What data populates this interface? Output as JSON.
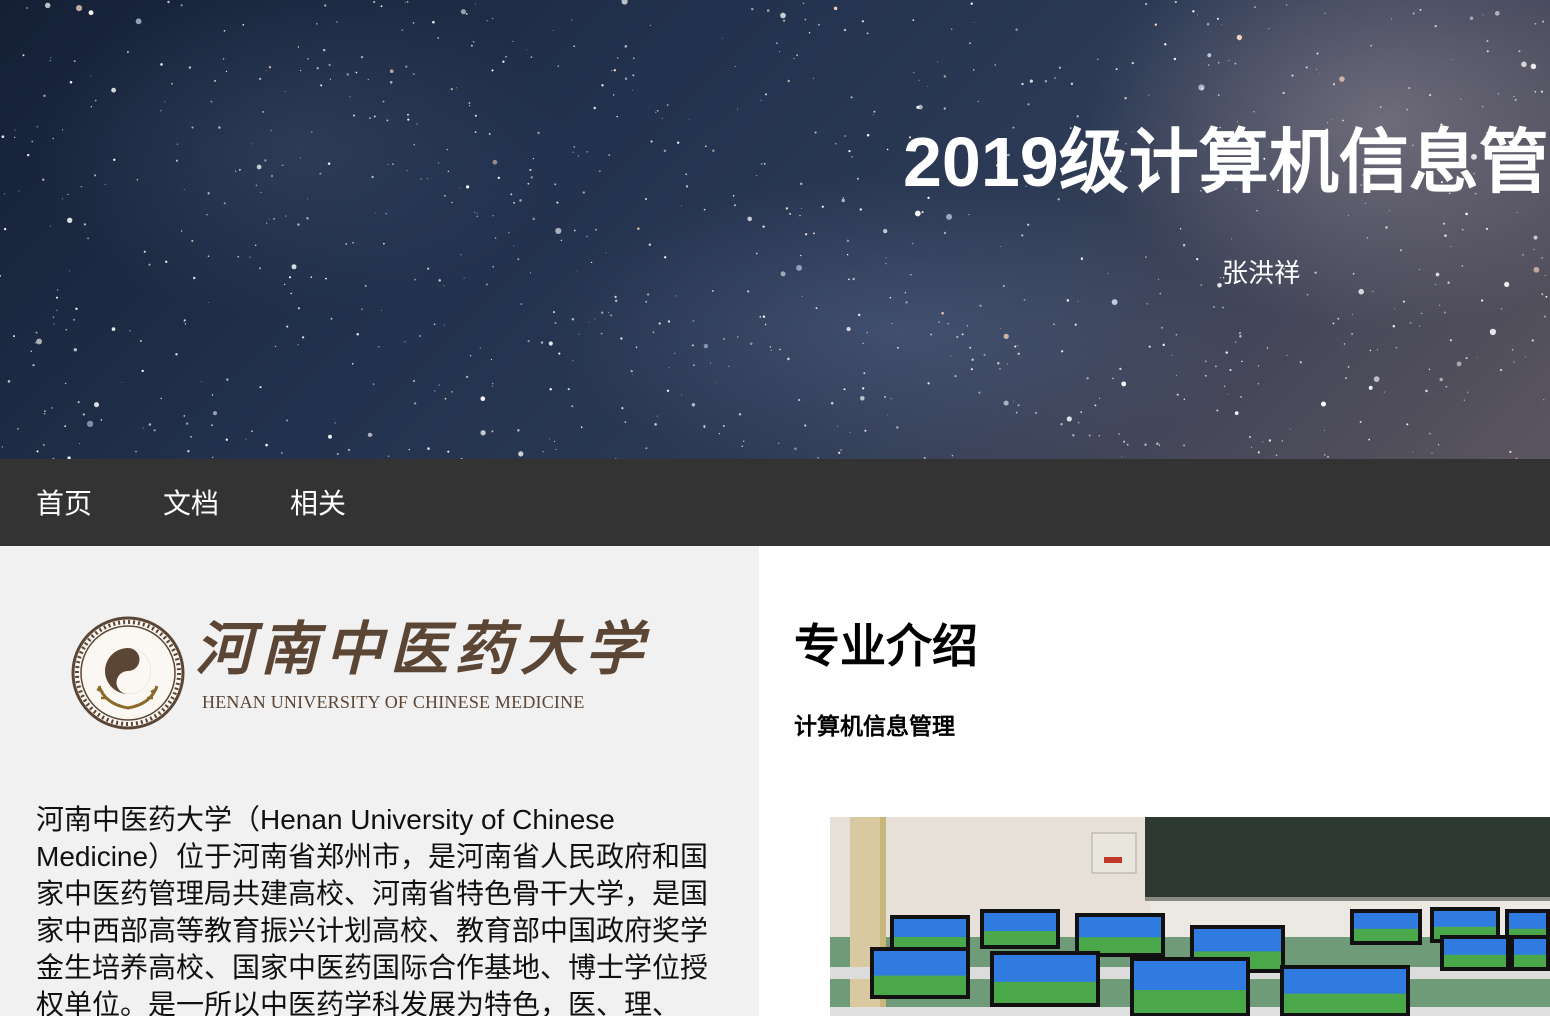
{
  "header": {
    "title": "2019级计算机信息管",
    "subtitle": "张洪祥"
  },
  "nav": {
    "items": [
      {
        "label": "首页"
      },
      {
        "label": "文档"
      },
      {
        "label": "相关"
      }
    ]
  },
  "sidebar": {
    "logo": {
      "name_cn": "河南中医药大学",
      "name_en": "HENAN UNIVERSITY OF CHINESE MEDICINE"
    },
    "intro": "河南中医药大学（Henan University of Chinese Medicine）位于河南省郑州市，是河南省人民政府和国家中医药管理局共建高校、河南省特色骨干大学，是国家中西部高等教育振兴计划高校、教育部中国政府奖学金生培养高校、国家中医药国际合作基地、博士学位授权单位。是一所以中医药学科发展为特色，医、理、"
  },
  "main": {
    "title": "专业介绍",
    "subtitle": "计算机信息管理"
  },
  "colors": {
    "navbar": "#333333",
    "sidebar": "#f1f1f1",
    "logo_brown": "#5b4535"
  }
}
